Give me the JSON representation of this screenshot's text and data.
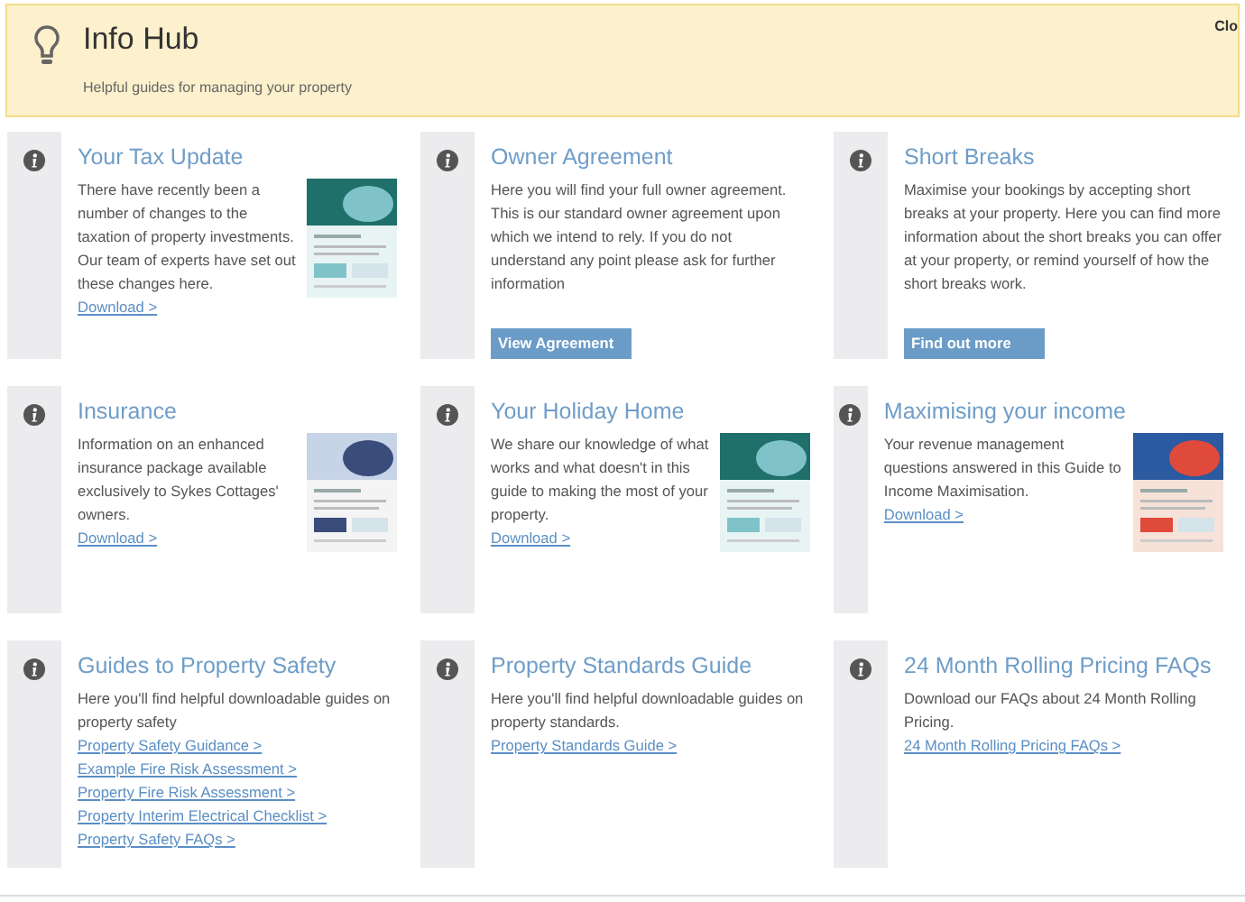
{
  "header": {
    "title": "Info Hub",
    "subtitle": "Helpful guides for managing your property",
    "close": "Clo"
  },
  "cards": [
    {
      "title": "Your Tax Update",
      "text": "There have recently been a number of changes to the taxation of property investments. Our team of experts have set out these changes here.",
      "links": [
        "Download >"
      ]
    },
    {
      "title": "Owner Agreement",
      "text": "Here you will find your full owner agreement. This is our standard owner agreement upon which we intend to rely. If you do not understand any point please ask for further information",
      "button": "View Agreement"
    },
    {
      "title": "Short Breaks",
      "text": "Maximise your bookings by accepting short breaks at your property. Here you can find more information about the short breaks you can offer at your property, or remind yourself of how the short breaks work.",
      "button": "Find out more"
    },
    {
      "title": "Insurance",
      "text": "Information on an enhanced insurance package available exclusively to Sykes Cottages' owners.",
      "links": [
        "Download >"
      ]
    },
    {
      "title": "Your Holiday Home",
      "text": "We share our knowledge of what works and what doesn't in this guide to making the most of your property.",
      "links": [
        "Download >"
      ]
    },
    {
      "title": "Maximising your income",
      "text": "Your revenue management questions answered in this Guide to Income Maximisation.",
      "links": [
        "Download >"
      ]
    },
    {
      "title": "Guides to Property Safety",
      "text": "Here you'll find helpful downloadable guides on property safety",
      "links": [
        "Property Safety Guidance >",
        "Example Fire Risk Assessment >",
        "Property Fire Risk Assessment >",
        "Property Interim Electrical Checklist >",
        "Property Safety FAQs >"
      ]
    },
    {
      "title": "Property Standards Guide",
      "text": "Here you'll find helpful downloadable guides on property standards.",
      "links": [
        "Property Standards Guide >"
      ]
    },
    {
      "title": "24 Month Rolling Pricing FAQs",
      "text": "Download our FAQs about 24 Month Rolling Pricing.",
      "links": [
        "24 Month Rolling Pricing FAQs >"
      ]
    }
  ]
}
